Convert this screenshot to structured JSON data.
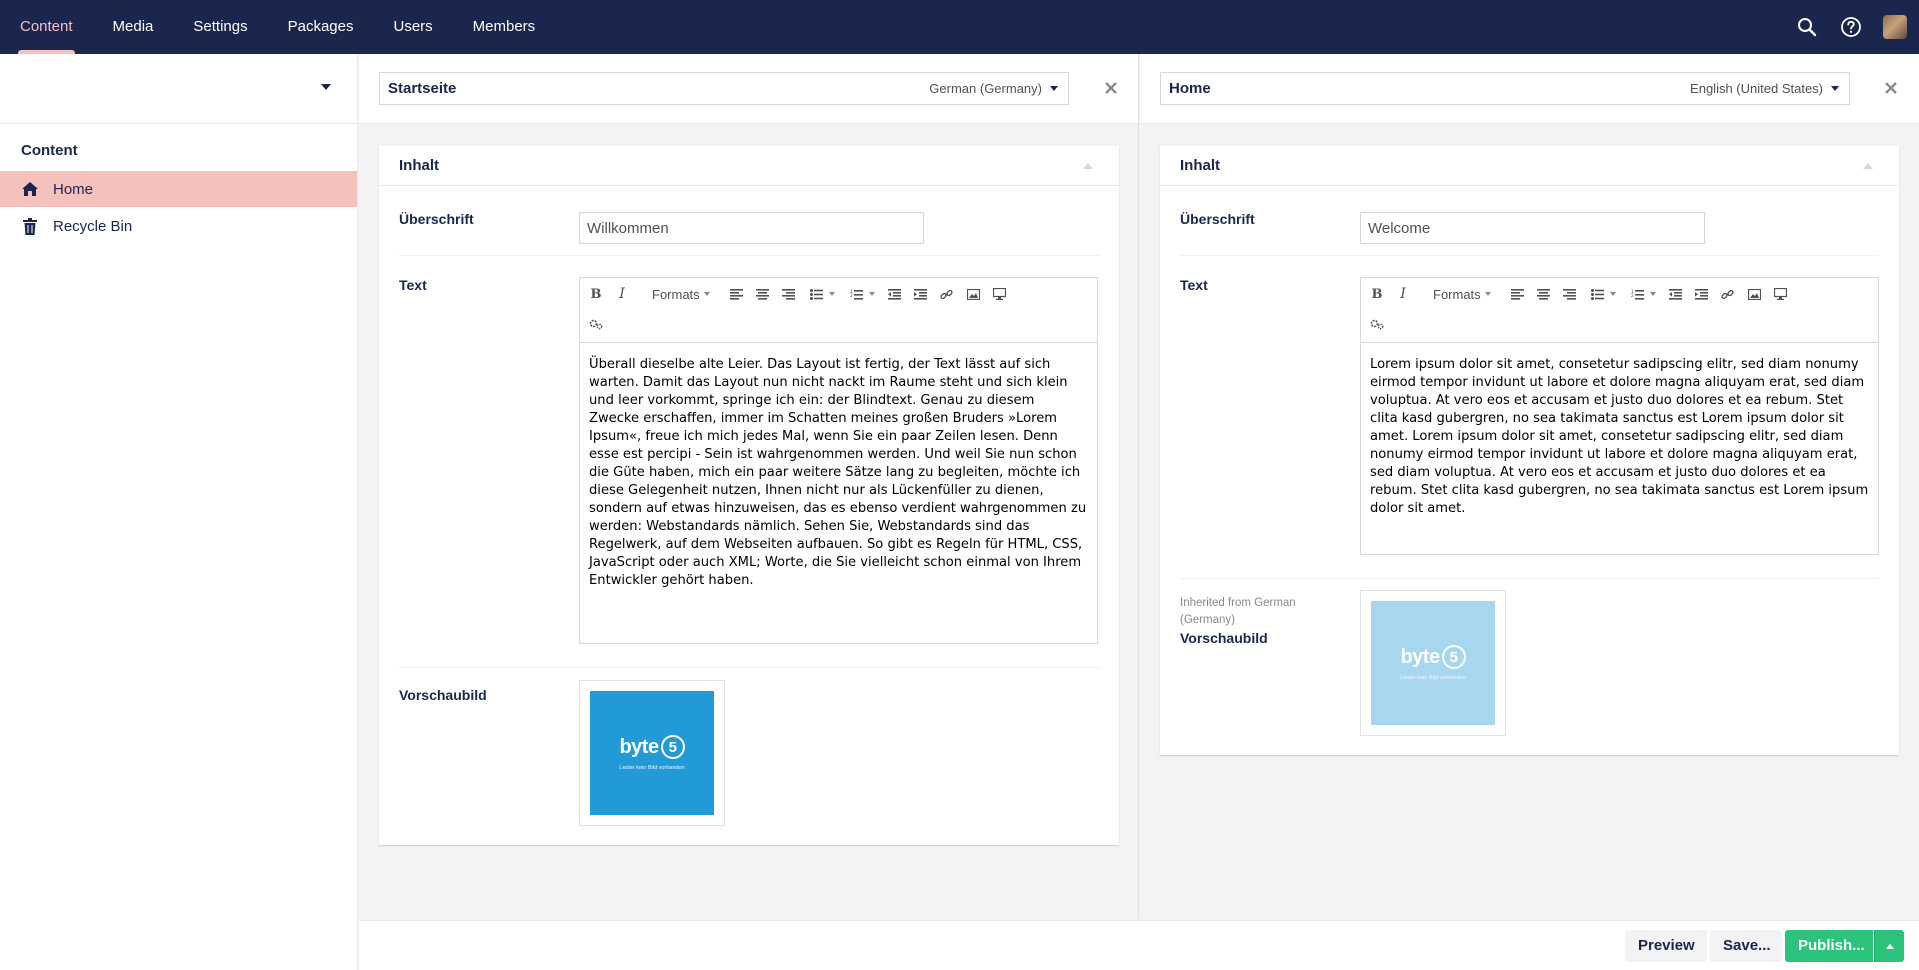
{
  "nav": {
    "sections": [
      "Content",
      "Media",
      "Settings",
      "Packages",
      "Users",
      "Members"
    ],
    "active_section": "Content",
    "accent_color": "#f5c1bc",
    "bar_color": "#1b264f",
    "tools": [
      "search-icon",
      "help-icon",
      "avatar"
    ]
  },
  "tree": {
    "root_label": "Content",
    "items": [
      {
        "label": "Home",
        "icon": "home-icon",
        "active": true
      },
      {
        "label": "Recycle Bin",
        "icon": "trash-icon",
        "active": false
      }
    ]
  },
  "editors": [
    {
      "name": "Startseite",
      "language": "German (Germany)",
      "group": "Inhalt",
      "heading_label": "Überschrift",
      "heading_value": "Willkommen",
      "text_label": "Text",
      "text_value": "Überall dieselbe alte Leier. Das Layout ist fertig, der Text lässt auf sich warten. Damit das Layout nun nicht nackt im Raume steht und sich klein und leer vorkommt, springe ich ein: der Blindtext. Genau zu diesem Zwecke erschaffen, immer im Schatten meines großen Bruders »Lorem Ipsum«, freue ich mich jedes Mal, wenn Sie ein paar Zeilen lesen. Denn esse est percipi - Sein ist wahrgenommen werden. Und weil Sie nun schon die Güte haben, mich ein paar weitere Sätze lang zu begleiten, möchte ich diese Gelegenheit nutzen, Ihnen nicht nur als Lückenfüller zu dienen, sondern auf etwas hinzuweisen, das es ebenso verdient wahrgenommen zu werden: Webstandards nämlich. Sehen Sie, Webstandards sind das Regelwerk, auf dem Webseiten aufbauen. So gibt es Regeln für HTML, CSS, JavaScript oder auch XML; Worte, die Sie vielleicht schon einmal von Ihrem Entwickler gehört haben.",
      "image_label": "Vorschaubild",
      "inherited_note": "",
      "image_brand": "byte",
      "image_digit": "5",
      "image_caption": "Leider kein Bild vorhanden"
    },
    {
      "name": "Home",
      "language": "English (United States)",
      "group": "Inhalt",
      "heading_label": "Überschrift",
      "heading_value": "Welcome",
      "text_label": "Text",
      "text_value": "Lorem ipsum dolor sit amet, consetetur sadipscing elitr, sed diam nonumy eirmod tempor invidunt ut labore et dolore magna aliquyam erat, sed diam voluptua. At vero eos et accusam et justo duo dolores et ea rebum. Stet clita kasd gubergren, no sea takimata sanctus est Lorem ipsum dolor sit amet. Lorem ipsum dolor sit amet, consetetur sadipscing elitr, sed diam nonumy eirmod tempor invidunt ut labore et dolore magna aliquyam erat, sed diam voluptua. At vero eos et accusam et justo duo dolores et ea rebum. Stet clita kasd gubergren, no sea takimata sanctus est Lorem ipsum dolor sit amet.",
      "image_label": "Vorschaubild",
      "inherited_note": "Inherited from German (Germany)",
      "image_brand": "byte",
      "image_digit": "5",
      "image_caption": "Leider kein Bild vorhanden"
    }
  ],
  "toolbar": {
    "formats_label": "Formats",
    "buttons": [
      "bold-icon",
      "italic-icon",
      "formats-dropdown",
      "align-left-icon",
      "align-center-icon",
      "align-right-icon",
      "bullet-list-icon",
      "numbered-list-icon",
      "outdent-icon",
      "indent-icon",
      "link-icon",
      "image-icon",
      "embed-icon",
      "macro-icon"
    ]
  },
  "footer": {
    "preview_label": "Preview",
    "save_label": "Save...",
    "publish_label": "Publish...",
    "publish_color": "#2bc37c"
  }
}
